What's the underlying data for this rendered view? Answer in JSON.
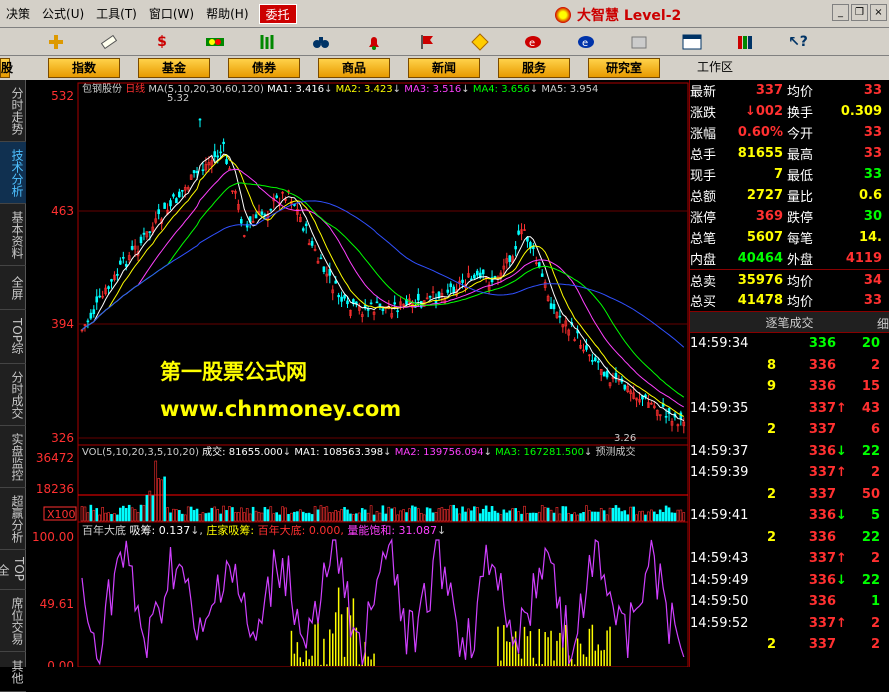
{
  "menu": {
    "items": [
      "决策",
      "公式(U)",
      "工具(T)",
      "窗口(W)",
      "帮助(H)"
    ],
    "hot": "委托",
    "brand": "大智慧 Level-2"
  },
  "toolbar_icons": [
    "plus-icon",
    "measure-icon",
    "dollar-icon",
    "bars-icon",
    "candles-icon",
    "binoculars-icon",
    "bell-icon",
    "flag-icon",
    "diamond-icon",
    "shield-icon",
    "globe-icon",
    "calculator-icon",
    "window-icon",
    "books-icon",
    "help-icon"
  ],
  "nav": {
    "buttons": [
      "股",
      "指数",
      "基金",
      "债券",
      "商品",
      "新闻",
      "服务",
      "研究室"
    ],
    "workspace": "工作区"
  },
  "sidebar": {
    "items": [
      "分时走势",
      "技术分析",
      "基本资料",
      "全屏",
      "TOP综",
      "分时成交",
      "实盘监控",
      "超赢分析",
      "TOP全",
      "席位交易",
      "其他"
    ]
  },
  "main_chart": {
    "stock": "包钢股份",
    "period": "日线",
    "ma_header": "MA(5,10,20,30,60,120)",
    "ma1": "MA1: 3.416",
    "ma2": "MA2: 3.423",
    "ma3": "MA3: 3.516",
    "ma4": "MA4: 3.656",
    "ma5": "MA5: 3.954",
    "high_label": "5.32",
    "low_label": "3.26",
    "ticks": [
      "532",
      "463",
      "394",
      "326"
    ]
  },
  "vol_chart": {
    "header": "VOL(5,10,20,3,5,10,20)",
    "chengjiao": "成交: 81655.000",
    "ma1": "MA1: 108563.398",
    "ma2": "MA2: 139756.094",
    "ma3": "MA3: 167281.500",
    "yuce": "预测成交",
    "ticks": [
      "36472",
      "18236"
    ],
    "unit": "X100"
  },
  "ind_chart": {
    "name": "百年大底",
    "xichou": "吸筹: 0.137",
    "zhuang": "庄家吸筹:",
    "bainian": "百年大底: 0.000,",
    "liangneng": "量能饱和: 31.087",
    "ticks": [
      "100.00",
      "49.61",
      "0.00"
    ]
  },
  "watermark": {
    "line1": "第一股票公式网",
    "line2": "www.chnmoney.com"
  },
  "quote": {
    "rows": [
      {
        "k": "最新",
        "v": "337",
        "vc": "#ff3030",
        "k2": "均价",
        "v2": "33",
        "v2c": "#ff3030"
      },
      {
        "k": "涨跌",
        "v": "↓002",
        "vc": "#ff3030",
        "k2": "换手",
        "v2": "0.309",
        "v2c": "#ffff00"
      },
      {
        "k": "涨幅",
        "v": "0.60%",
        "vc": "#ff3030",
        "k2": "今开",
        "v2": "33",
        "v2c": "#ff3030"
      },
      {
        "k": "总手",
        "v": "81655",
        "vc": "#ffff00",
        "k2": "最高",
        "v2": "33",
        "v2c": "#ff3030"
      },
      {
        "k": "现手",
        "v": "7",
        "vc": "#ffff00",
        "k2": "最低",
        "v2": "33",
        "v2c": "#00ff00"
      },
      {
        "k": "总额",
        "v": "2727",
        "vc": "#ffff00",
        "k2": "量比",
        "v2": "0.6",
        "v2c": "#ffff00"
      },
      {
        "k": "涨停",
        "v": "369",
        "vc": "#ff3030",
        "k2": "跌停",
        "v2": "30",
        "v2c": "#00ff00"
      },
      {
        "k": "总笔",
        "v": "5607",
        "vc": "#ffff00",
        "k2": "每笔",
        "v2": "14.",
        "v2c": "#ffff00"
      },
      {
        "k": "内盘",
        "v": "40464",
        "vc": "#00ff00",
        "k2": "外盘",
        "v2": "4119",
        "v2c": "#ff3030"
      },
      {
        "k": "总卖",
        "v": "35976",
        "vc": "#ffff00",
        "k2": "均价",
        "v2": "34",
        "v2c": "#ff3030"
      },
      {
        "k": "总买",
        "v": "41478",
        "vc": "#ffff00",
        "k2": "均价",
        "v2": "33",
        "v2c": "#ff3030"
      }
    ],
    "ticks_title": "逐笔成交",
    "ticks_extra": "细",
    "ticks": [
      {
        "t": "14:59:34",
        "q": "",
        "p": "336",
        "pc": "#00ff00",
        "a": "",
        "n": "20",
        "nc": "#00ff00"
      },
      {
        "t": "",
        "q": "8",
        "p": "336",
        "pc": "#ff3030",
        "a": "",
        "n": "2",
        "nc": "#ff3030"
      },
      {
        "t": "",
        "q": "9",
        "p": "336",
        "pc": "#ff3030",
        "a": "",
        "n": "15",
        "nc": "#ff3030"
      },
      {
        "t": "14:59:35",
        "q": "",
        "p": "337",
        "pc": "#ff3030",
        "a": "↑",
        "n": "43",
        "nc": "#ff3030"
      },
      {
        "t": "",
        "q": "2",
        "p": "337",
        "pc": "#ff3030",
        "a": "",
        "n": "6",
        "nc": "#ff3030"
      },
      {
        "t": "14:59:37",
        "q": "",
        "p": "336",
        "pc": "#ff3030",
        "a": "↓",
        "n": "22",
        "nc": "#00ff00"
      },
      {
        "t": "14:59:39",
        "q": "",
        "p": "337",
        "pc": "#ff3030",
        "a": "↑",
        "n": "2",
        "nc": "#ff3030"
      },
      {
        "t": "",
        "q": "2",
        "p": "337",
        "pc": "#ff3030",
        "a": "",
        "n": "50",
        "nc": "#ff3030"
      },
      {
        "t": "14:59:41",
        "q": "",
        "p": "336",
        "pc": "#ff3030",
        "a": "↓",
        "n": "5",
        "nc": "#00ff00"
      },
      {
        "t": "",
        "q": "2",
        "p": "336",
        "pc": "#ff3030",
        "a": "",
        "n": "22",
        "nc": "#00ff00"
      },
      {
        "t": "14:59:43",
        "q": "",
        "p": "337",
        "pc": "#ff3030",
        "a": "↑",
        "n": "2",
        "nc": "#ff3030"
      },
      {
        "t": "14:59:49",
        "q": "",
        "p": "336",
        "pc": "#ff3030",
        "a": "↓",
        "n": "22",
        "nc": "#00ff00"
      },
      {
        "t": "14:59:50",
        "q": "",
        "p": "336",
        "pc": "#ff3030",
        "a": "",
        "n": "1",
        "nc": "#00ff00"
      },
      {
        "t": "14:59:52",
        "q": "",
        "p": "337",
        "pc": "#ff3030",
        "a": "↑",
        "n": "2",
        "nc": "#ff3030"
      },
      {
        "t": "",
        "q": "2",
        "p": "337",
        "pc": "#ff3030",
        "a": "",
        "n": "2",
        "nc": "#ff3030"
      }
    ]
  }
}
